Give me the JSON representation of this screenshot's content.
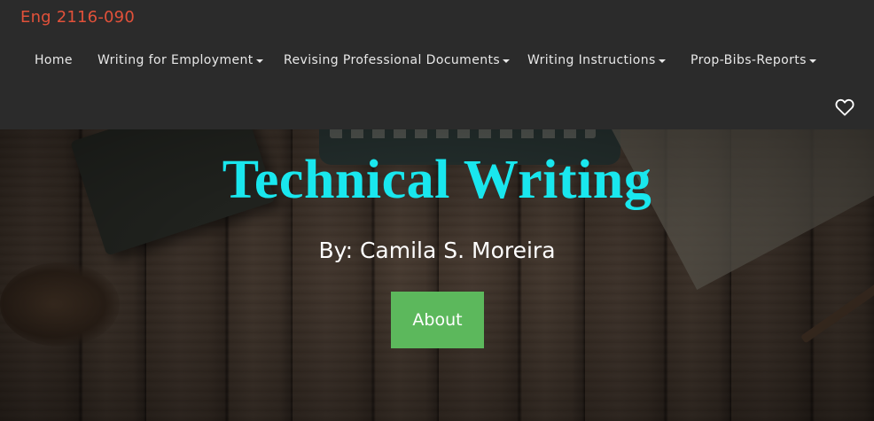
{
  "site": {
    "title": "Eng 2116-090",
    "accent_color": "#e2513a"
  },
  "nav": {
    "items": [
      {
        "label": "Home",
        "has_dropdown": false
      },
      {
        "label": "Writing for Employment",
        "has_dropdown": true
      },
      {
        "label": "Revising Professional Documents",
        "has_dropdown": true
      },
      {
        "label": "Writing Instructions",
        "has_dropdown": true
      },
      {
        "label": "Prop-Bibs-Reports",
        "has_dropdown": true
      }
    ],
    "favorite_icon": "heart-outline-icon"
  },
  "hero": {
    "title": "Technical Writing",
    "subtitle": "By: Camila S. Moreira",
    "button_label": "About",
    "title_color": "#19e7ee",
    "button_color": "#5cb85c"
  }
}
